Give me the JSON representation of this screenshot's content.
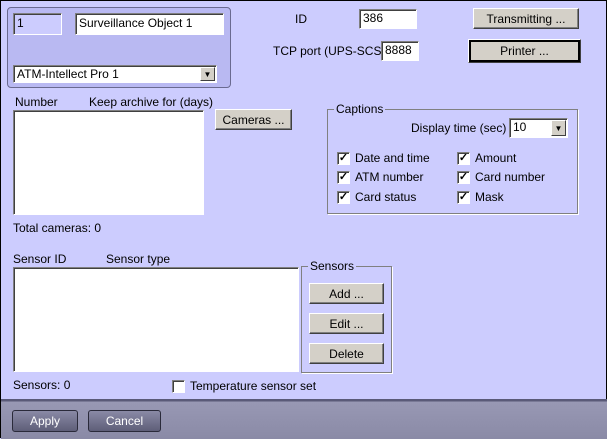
{
  "object": {
    "number": "1",
    "name": "Surveillance Object 1",
    "device": "ATM-Intellect Pro 1"
  },
  "id_label": "ID",
  "id_value": "386",
  "tcp_label": "TCP port (UPS-SCS)",
  "tcp_value": "8888",
  "buttons": {
    "transmitting": "Transmitting ...",
    "printer": "Printer ...",
    "cameras": "Cameras ...",
    "add": "Add ...",
    "edit": "Edit ...",
    "delete": "Delete",
    "apply": "Apply",
    "cancel": "Cancel"
  },
  "cameras": {
    "col_number": "Number",
    "col_archive": "Keep archive for (days)",
    "total": "Total cameras: 0"
  },
  "captions": {
    "title": "Captions",
    "display_time_label": "Display time (sec) :",
    "display_time_value": "10",
    "checks": [
      {
        "label": "Date and time",
        "checked": true
      },
      {
        "label": "Amount",
        "checked": true
      },
      {
        "label": "ATM number",
        "checked": true
      },
      {
        "label": "Card number",
        "checked": true
      },
      {
        "label": "Card status",
        "checked": true
      },
      {
        "label": "Mask",
        "checked": true
      }
    ]
  },
  "sensors": {
    "col_id": "Sensor ID",
    "col_type": "Sensor type",
    "group_title": "Sensors",
    "count": "Sensors: 0",
    "temperature_label": "Temperature sensor set",
    "temperature_checked": false
  }
}
